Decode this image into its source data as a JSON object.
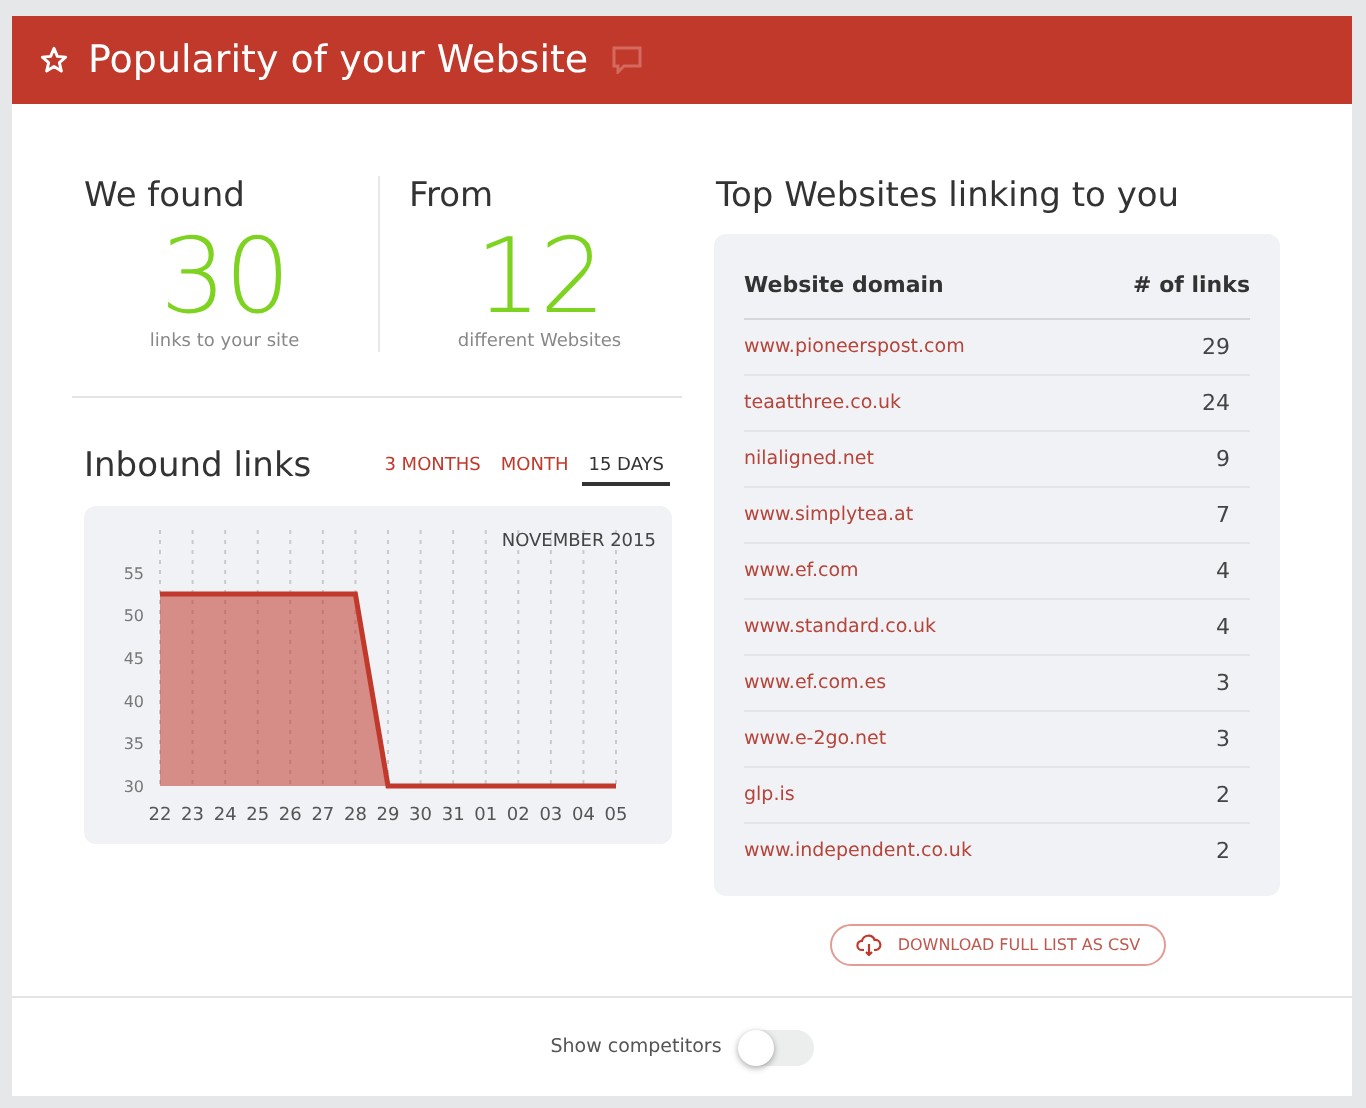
{
  "header": {
    "title": "Popularity of your Website"
  },
  "stats": [
    {
      "label": "We found",
      "value": "30",
      "caption": "links to your site"
    },
    {
      "label": "From",
      "value": "12",
      "caption": "different Websites"
    }
  ],
  "inbound": {
    "title": "Inbound links",
    "ranges": [
      {
        "label": "3 MONTHS",
        "selected": false
      },
      {
        "label": "MONTH",
        "selected": false
      },
      {
        "label": "15 DAYS",
        "selected": true
      }
    ],
    "chart_data": {
      "type": "area",
      "title": "NOVEMBER 2015",
      "categories": [
        "22",
        "23",
        "24",
        "25",
        "26",
        "27",
        "28",
        "29",
        "30",
        "31",
        "01",
        "02",
        "03",
        "04",
        "05"
      ],
      "series": [
        {
          "color": "#c0392b",
          "values": [
            52.5,
            52.5,
            52.5,
            52.5,
            52.5,
            52.5,
            52.5,
            30,
            30,
            30,
            30,
            30,
            30,
            30,
            30
          ]
        }
      ],
      "grid": true,
      "ylim": [
        30,
        60
      ],
      "yticks": [
        30,
        35,
        40,
        45,
        50,
        55
      ]
    }
  },
  "top_sites": {
    "title": "Top Websites linking to you",
    "columns": [
      "Website domain",
      "# of links"
    ],
    "rows": [
      {
        "domain": "www.pioneerspost.com",
        "links": "29"
      },
      {
        "domain": "teaatthree.co.uk",
        "links": "24"
      },
      {
        "domain": "nilaligned.net",
        "links": "9"
      },
      {
        "domain": "www.simplytea.at",
        "links": "7"
      },
      {
        "domain": "www.ef.com",
        "links": "4"
      },
      {
        "domain": "www.standard.co.uk",
        "links": "4"
      },
      {
        "domain": "www.ef.com.es",
        "links": "3"
      },
      {
        "domain": "www.e-2go.net",
        "links": "3"
      },
      {
        "domain": "glp.is",
        "links": "2"
      },
      {
        "domain": "www.independent.co.uk",
        "links": "2"
      }
    ],
    "download_button": "DOWNLOAD FULL LIST AS CSV"
  },
  "footer": {
    "toggle": {
      "label": "Show competitors",
      "on": false
    }
  }
}
